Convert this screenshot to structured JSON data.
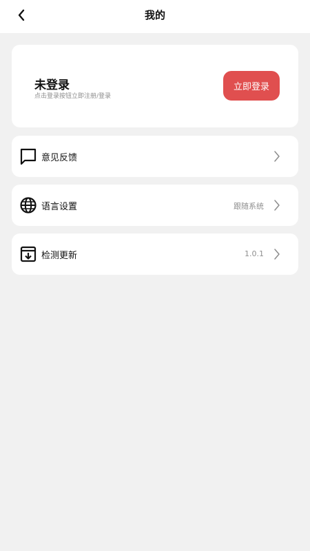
{
  "header": {
    "title": "我的",
    "back_icon": "chevron-left-icon"
  },
  "profile": {
    "name": "未登录",
    "hint": "点击登录按钮立即注册/登录",
    "login_button": "立即登录",
    "accent_color": "#e04f4f"
  },
  "menu": [
    {
      "label": "意见反馈",
      "value": "",
      "icon": "message-square-icon"
    },
    {
      "label": "语言设置",
      "value": "跟随系统",
      "icon": "globe-icon"
    },
    {
      "label": "检测更新",
      "value": "1.0.1",
      "icon": "download-box-icon"
    }
  ]
}
